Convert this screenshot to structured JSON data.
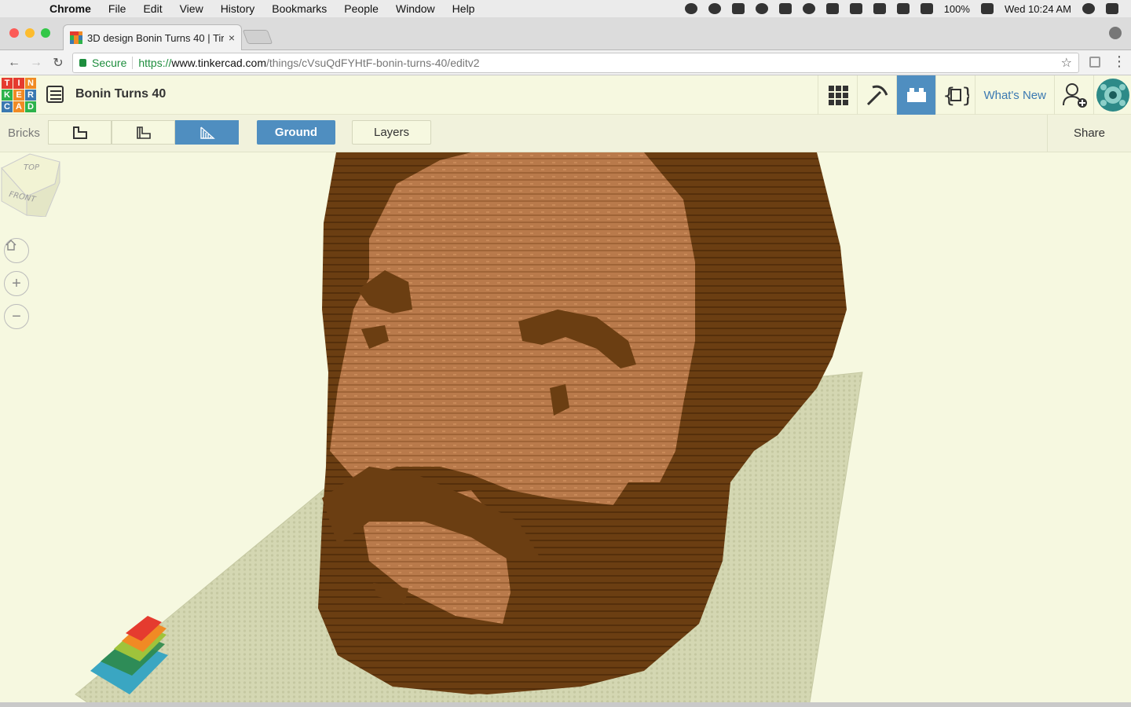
{
  "menubar": {
    "apple": "",
    "items": [
      "Chrome",
      "File",
      "Edit",
      "View",
      "History",
      "Bookmarks",
      "People",
      "Window",
      "Help"
    ],
    "battery": "100%",
    "clock": "Wed 10:24 AM"
  },
  "tab": {
    "title": "3D design Bonin Turns 40 | Tir",
    "close": "×"
  },
  "address": {
    "secure_label": "Secure",
    "scheme": "https://",
    "host": "www.tinkercad.com",
    "path": "/things/cVsuQdFYHtF-bonin-turns-40/editv2",
    "star": "☆"
  },
  "logo": {
    "letters": [
      "T",
      "I",
      "N",
      "K",
      "E",
      "R",
      "C",
      "A",
      "D"
    ],
    "colors": [
      "#e53b2f",
      "#e53b2f",
      "#f08a24",
      "#2db24b",
      "#f08a24",
      "#3b79b1",
      "#3b79b1",
      "#f08a24",
      "#2db24b"
    ]
  },
  "header": {
    "design_title": "Bonin Turns 40",
    "whats_new": "What's New"
  },
  "subbar": {
    "bricks_label": "Bricks",
    "ground_label": "Ground",
    "layers_label": "Layers",
    "share_label": "Share"
  },
  "viewcube": {
    "top": "TOP",
    "front": "FRONT"
  },
  "colors": {
    "accent": "#4f8ec0",
    "skin": "#b8774a",
    "hair": "#6b3e12",
    "ground": "#d9dcbb"
  }
}
